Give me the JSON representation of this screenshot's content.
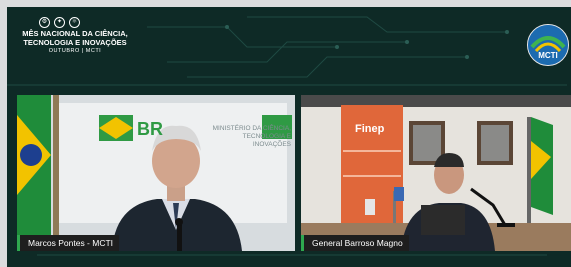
{
  "event": {
    "title": "MÊS NACIONAL DA CIÊNCIA, TECNOLOGIA E INOVAÇÕES",
    "subtitle": "OUTUBRO | MCTI"
  },
  "badge": {
    "label": "MCTI"
  },
  "left_tile": {
    "name": "Marcos Pontes - MCTI",
    "backdrop_text": "MINISTÉRIO DA CIÊNCIA, TECNOLOGIA E INOVAÇÕES",
    "backdrop_brand": "BR"
  },
  "right_tile": {
    "name": "General Barroso Magno",
    "banner_brand": "Finep"
  },
  "colors": {
    "background": "#0e2a26",
    "name_tag_accent": "#2fa84f",
    "finep_orange": "#e0673a"
  }
}
